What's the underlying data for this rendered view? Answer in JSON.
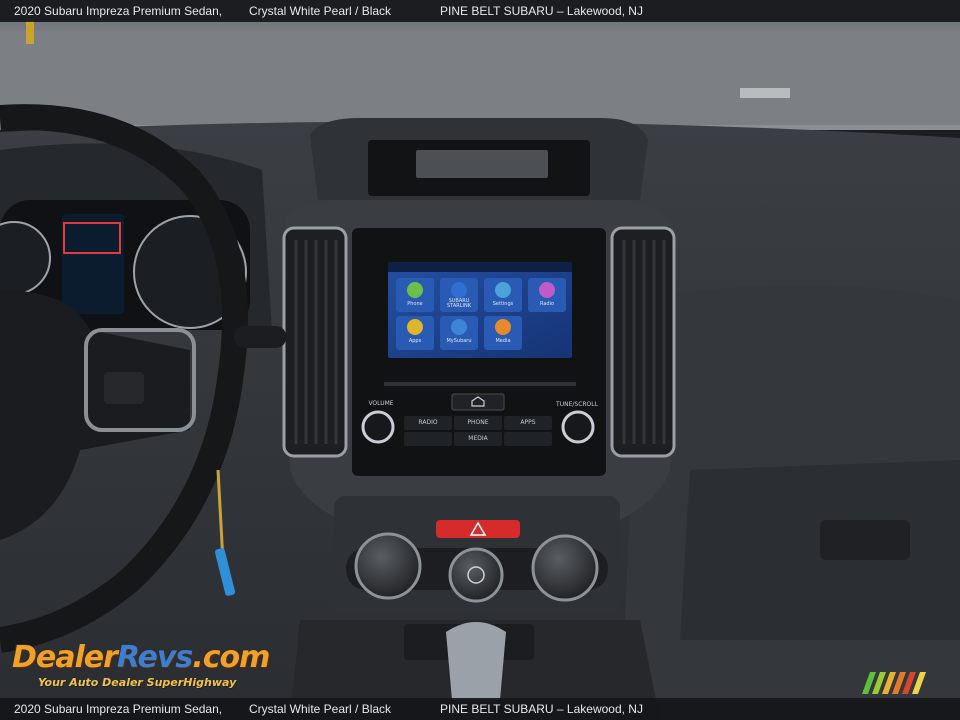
{
  "caption": {
    "model": "2020 Subaru Impreza Premium Sedan,",
    "color": "Crystal White Pearl / Black",
    "dealer": "PINE BELT SUBARU – Lakewood, NJ"
  },
  "infotainment": {
    "tiles": [
      {
        "label": "Phone",
        "icon": "phone-icon",
        "color": "#6cc04a"
      },
      {
        "label": "SUBARU STARLINK",
        "icon": "starlink-icon",
        "color": "#2f6fd1"
      },
      {
        "label": "Settings",
        "icon": "gear-icon",
        "color": "#4aa3d9"
      },
      {
        "label": "Radio",
        "icon": "radio-icon",
        "color": "#c05ac7"
      },
      {
        "label": "Apps",
        "icon": "apps-icon",
        "color": "#e0b42e"
      },
      {
        "label": "MySubaru",
        "icon": "car-icon",
        "color": "#3d86d6"
      },
      {
        "label": "Media",
        "icon": "media-icon",
        "color": "#e88a2c"
      }
    ]
  },
  "head_unit": {
    "volume_label": "VOLUME",
    "tune_label": "TUNE/SCROLL",
    "radio_label": "RADIO",
    "phone_label": "PHONE",
    "apps_label": "APPS",
    "media_label": "MEDIA"
  },
  "logo": {
    "main_a": "Dealer",
    "main_b": "Revs",
    "main_c": ".com",
    "tagline": "Your Auto Dealer SuperHighway"
  },
  "colors": {
    "hazard": "#d62b2b",
    "screen_bg": "#1d3c86"
  }
}
